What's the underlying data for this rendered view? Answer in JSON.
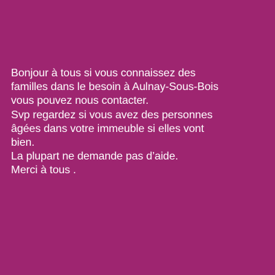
{
  "background_color": "#9e2570",
  "text_color": "#ffffff",
  "message": {
    "lines": [
      "Bonjour à tous si vous connaissez des",
      "familles dans le besoin à Aulnay-Sous-Bois",
      "vous pouvez nous contacter.",
      "Svp regardez si vous avez des personnes",
      "âgées dans votre immeuble si elles vont",
      "bien.",
      "La plupart ne demande pas d’aide.",
      "Merci à tous ."
    ]
  }
}
